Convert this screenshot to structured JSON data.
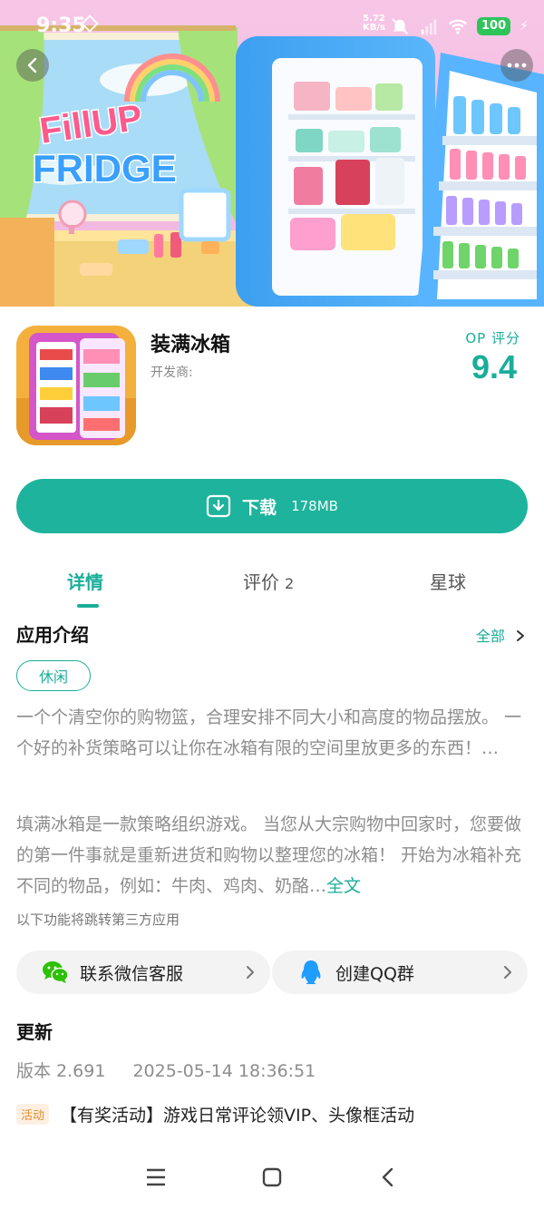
{
  "status_bar": {
    "time": "9:35",
    "net_speed_value": "5.72",
    "net_speed_unit": "KB/s",
    "battery": "100"
  },
  "banner": {
    "logo_line1": "FillUP",
    "logo_line2": "FRIDGE"
  },
  "app": {
    "name": "装满冰箱",
    "developer_label": "开发商:",
    "rating_label": "OP 评分",
    "rating_value": "9.4"
  },
  "download": {
    "label": "下载",
    "size": "178MB"
  },
  "tabs": [
    {
      "label": "详情",
      "active": true
    },
    {
      "label": "评价",
      "count": "2"
    },
    {
      "label": "星球"
    }
  ],
  "intro": {
    "title": "应用介绍",
    "more": "全部",
    "tag": "休闲",
    "paragraph1": "一个个清空你的购物篮，合理安排不同大小和高度的物品摆放。 一个好的补货策略可以让你在冰箱有限的空间里放更多的东西！…",
    "paragraph2": "填满冰箱是一款策略组织游戏。 当您从大宗购物中回家时，您要做的第一件事就是重新进货和购物以整理您的冰箱！ 开始为冰箱补充不同的物品，例如：牛肉、鸡肉、奶酪…",
    "full_text_link": "全文",
    "third_party_note": "以下功能将跳转第三方应用"
  },
  "services": {
    "wechat_label": "联系微信客服",
    "qq_label": "创建QQ群"
  },
  "update": {
    "title": "更新",
    "version": "版本 2.691",
    "datetime": "2025-05-14 18:36:51",
    "activity_badge": "活动",
    "activity_text": "【有奖活动】游戏日常评论领VIP、头像框活动"
  },
  "colors": {
    "accent": "#1eb39d",
    "accent_text": "#1aae9a",
    "battery": "#2ec45a",
    "badge_text": "#e58a2c"
  }
}
